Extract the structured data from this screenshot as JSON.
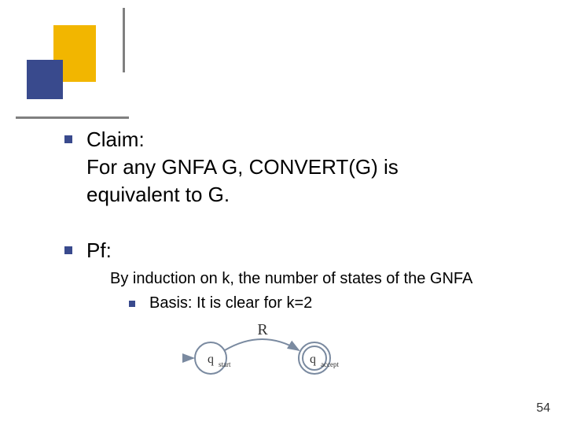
{
  "items": [
    {
      "type": "claim",
      "lines": [
        "Claim:",
        "For any GNFA G, CONVERT(G) is",
        "equivalent to G."
      ]
    },
    {
      "type": "pf",
      "label": "Pf:",
      "induction": "By induction on k, the number of states of the GNFA",
      "basis": "Basis: It is clear for k=2"
    }
  ],
  "diagram": {
    "start_label": "q",
    "start_sub": "start",
    "accept_label": "q",
    "accept_sub": "accept",
    "edge_label": "R"
  },
  "page_number": "54"
}
